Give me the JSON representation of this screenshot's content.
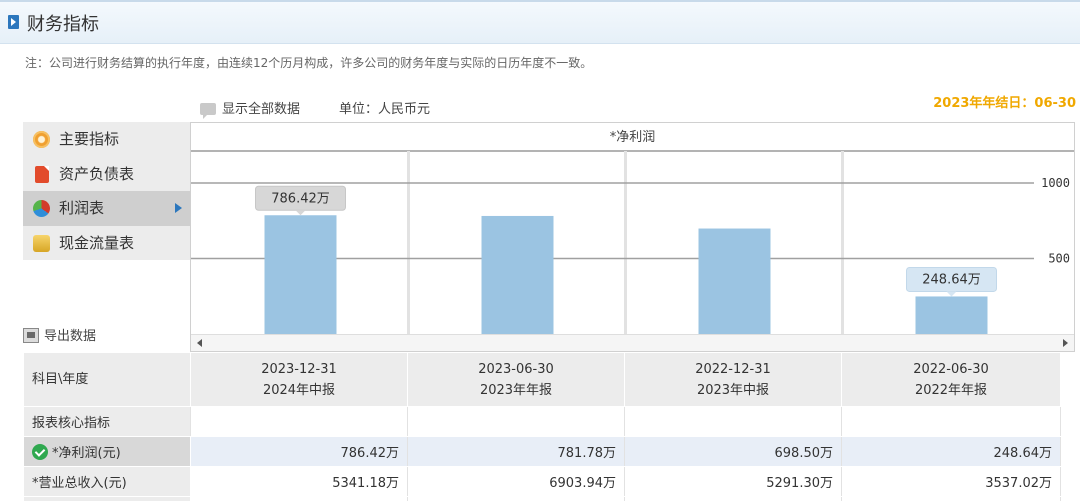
{
  "header": {
    "title": "财务指标"
  },
  "note": "注：公司进行财务结算的执行年度，由连续12个历月构成，许多公司的财务年度与实际的日历年度不一致。",
  "toolbar": {
    "show_all": "显示全部数据",
    "unit": "单位：人民币元"
  },
  "fiscal_year_end": "2023年年结日：06-30",
  "menu": {
    "items": [
      {
        "label": "主要指标",
        "icon": "gear-icon"
      },
      {
        "label": "资产负债表",
        "icon": "document-icon"
      },
      {
        "label": "利润表",
        "icon": "pie-chart-icon",
        "active": true
      },
      {
        "label": "现金流量表",
        "icon": "coins-icon"
      }
    ]
  },
  "export": {
    "label": "导出数据"
  },
  "chart_data": {
    "type": "bar",
    "title": "*净利润",
    "categories": [
      "2023-12-31",
      "2023-06-30",
      "2022-12-31",
      "2022-06-30"
    ],
    "values": [
      786.42,
      781.78,
      698.5,
      248.64
    ],
    "unit": "万",
    "y_ticks": [
      500,
      1000
    ],
    "ylim": [
      0,
      1212
    ],
    "data_labels": [
      "786.42万",
      "",
      "",
      "248.64万"
    ],
    "grid": true,
    "bar_color": "#9bc4e2"
  },
  "table": {
    "header_label": "科目\\年度",
    "columns": [
      {
        "date": "2023-12-31",
        "report": "2024年中报"
      },
      {
        "date": "2023-06-30",
        "report": "2023年年报"
      },
      {
        "date": "2022-12-31",
        "report": "2023年中报"
      },
      {
        "date": "2022-06-30",
        "report": "2022年年报"
      }
    ],
    "section": "报表核心指标",
    "rows": [
      {
        "label": "*净利润(元)",
        "values": [
          "786.42万",
          "781.78万",
          "698.50万",
          "248.64万"
        ],
        "checked": true
      },
      {
        "label": "*营业总收入(元)",
        "values": [
          "5341.18万",
          "6903.94万",
          "5291.30万",
          "3537.02万"
        ]
      }
    ]
  }
}
